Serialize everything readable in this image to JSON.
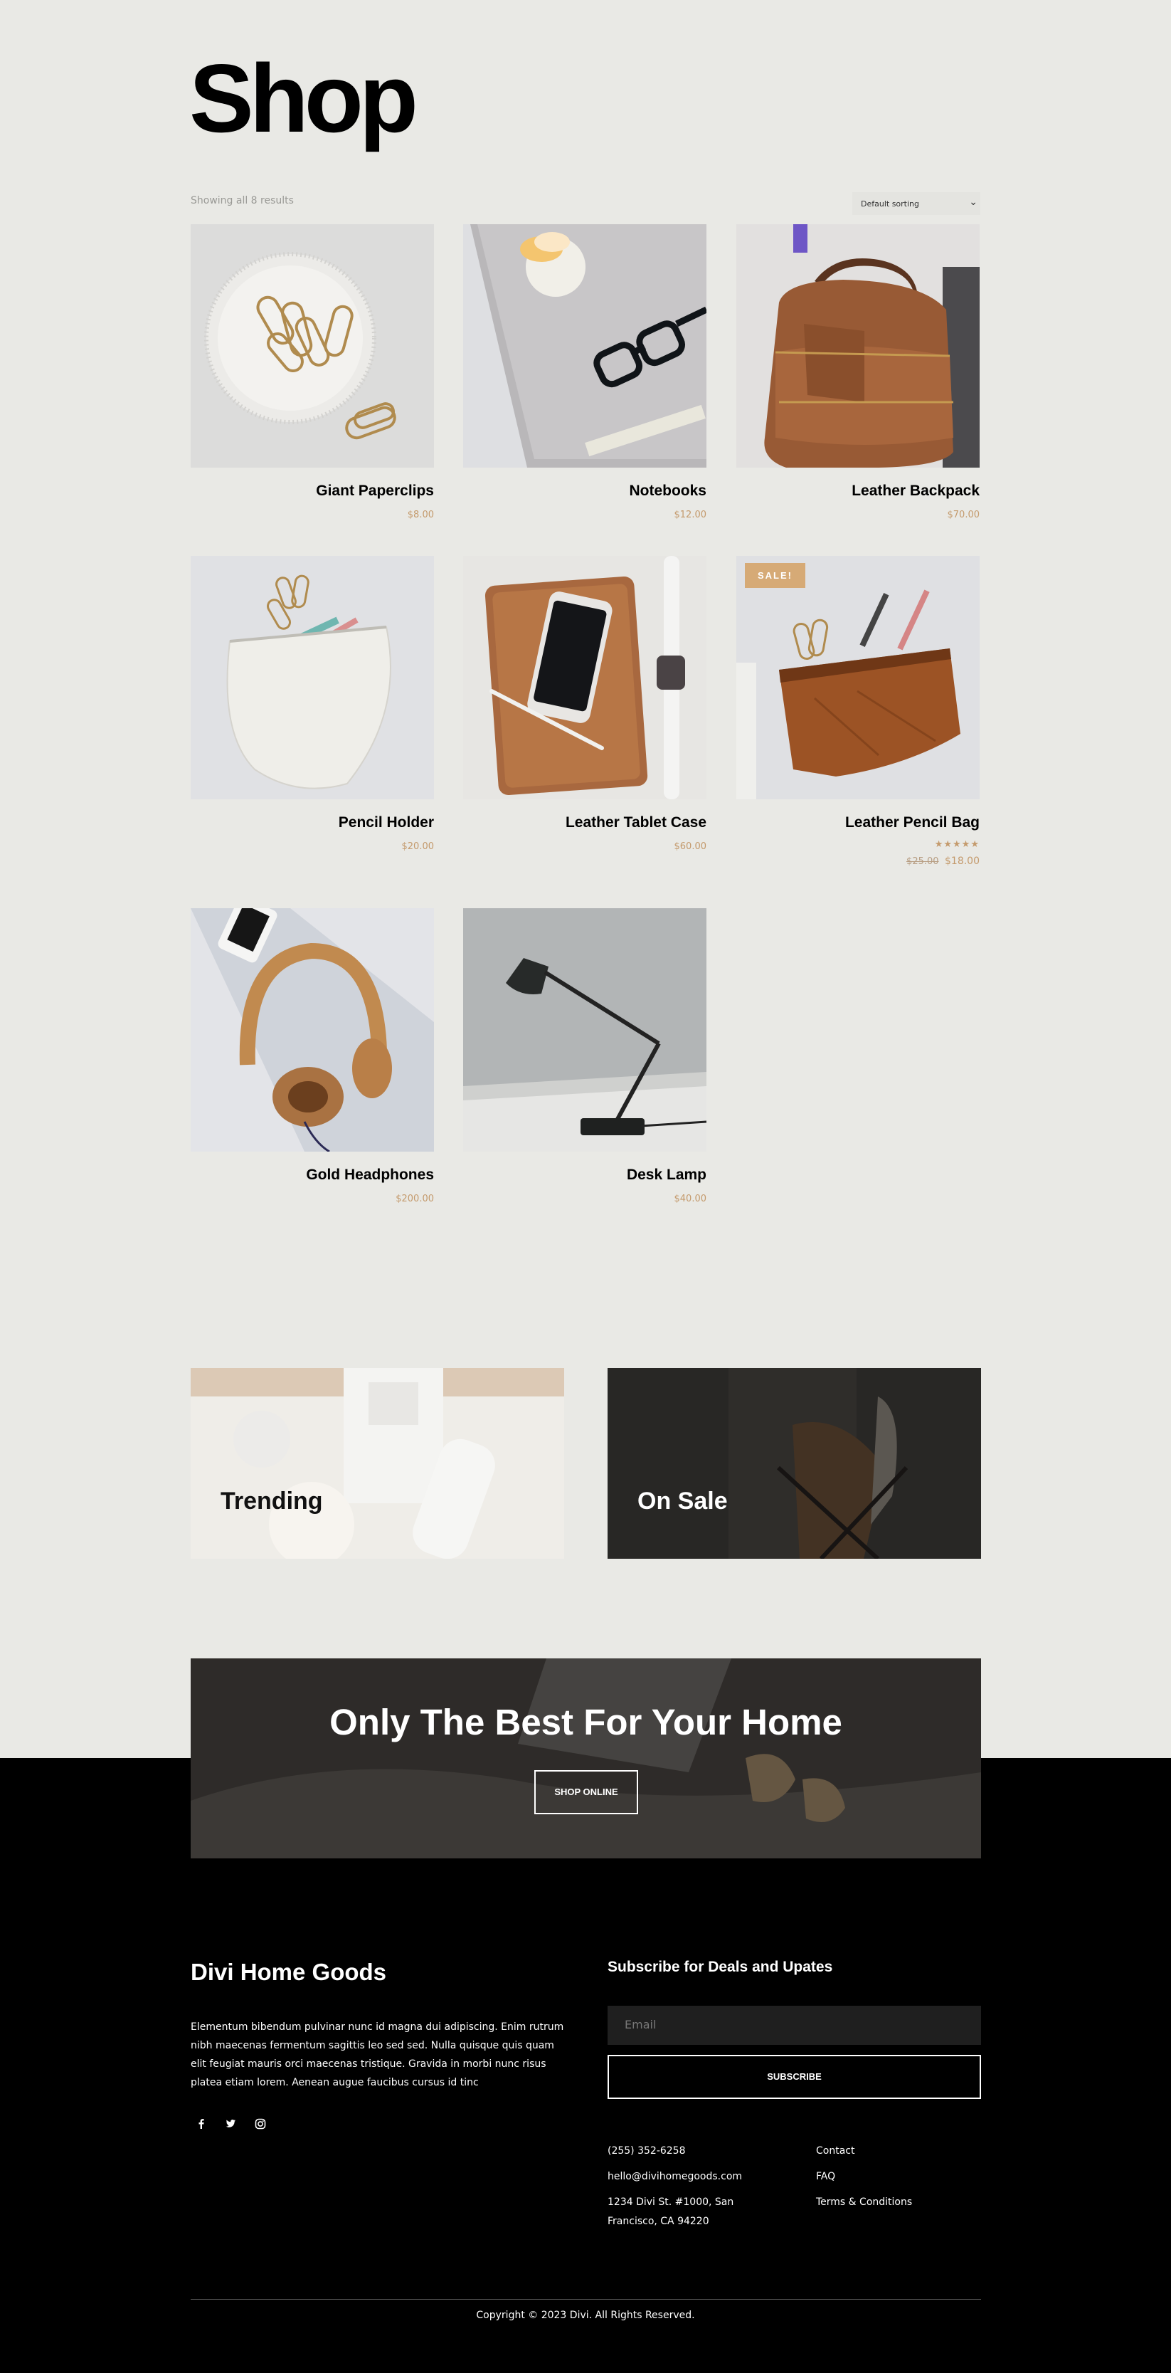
{
  "page": {
    "title": "Shop"
  },
  "toolbar": {
    "result_count": "Showing all 8 results",
    "sorting": "Default sorting"
  },
  "products": [
    {
      "name": "Giant Paperclips",
      "price": "$8.00"
    },
    {
      "name": "Notebooks",
      "price": "$12.00"
    },
    {
      "name": "Leather Backpack",
      "price": "$70.00"
    },
    {
      "name": "Pencil Holder",
      "price": "$20.00"
    },
    {
      "name": "Leather Tablet Case",
      "price": "$60.00"
    },
    {
      "name": "Leather Pencil Bag",
      "badge": "SALE!",
      "rating_stars": "★★★★★",
      "rating": 5,
      "old_price": "$25.00",
      "price": "$18.00"
    },
    {
      "name": "Gold Headphones",
      "price": "$200.00"
    },
    {
      "name": "Desk Lamp",
      "price": "$40.00"
    }
  ],
  "categories": [
    {
      "label": "Trending"
    },
    {
      "label": "On Sale"
    }
  ],
  "cta": {
    "title": "Only The Best For Your Home",
    "button": "SHOP ONLINE"
  },
  "footer": {
    "brand": "Divi Home Goods",
    "description": "Elementum bibendum pulvinar nunc id magna dui adipiscing. Enim rutrum nibh maecenas fermentum sagittis leo sed sed. Nulla quisque quis quam elit feugiat mauris orci maecenas tristique. Gravida in morbi nunc risus platea etiam lorem. Aenean augue faucibus cursus id tinc",
    "social": [
      "facebook-icon",
      "twitter-icon",
      "instagram-icon"
    ],
    "subscribe_title": "Subscribe for Deals and Upates",
    "email_placeholder": "Email",
    "subscribe_button": "SUBSCRIBE",
    "phone": "(255) 352-6258",
    "email": "hello@divihomegoods.com",
    "address_line1": "1234 Divi St. #1000, San",
    "address_line2": "Francisco, CA 94220",
    "links": [
      "Contact",
      "FAQ",
      "Terms & Conditions"
    ],
    "copyright": "Copyright © 2023 Divi. All Rights Reserved."
  }
}
